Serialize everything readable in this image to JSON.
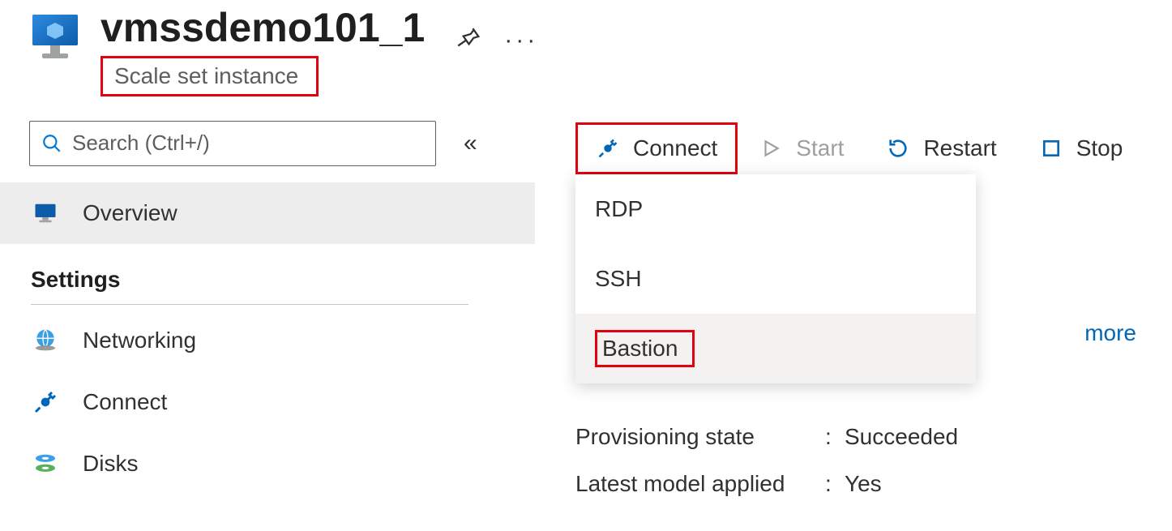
{
  "header": {
    "title": "vmssdemo101_1",
    "subtitle": "Scale set instance"
  },
  "sidebar": {
    "searchPlaceholder": "Search (Ctrl+/)",
    "overview": "Overview",
    "settingsTitle": "Settings",
    "items": {
      "networking": "Networking",
      "connect": "Connect",
      "disks": "Disks"
    }
  },
  "actions": {
    "connect": "Connect",
    "start": "Start",
    "restart": "Restart",
    "stop": "Stop"
  },
  "dropdown": {
    "rdp": "RDP",
    "ssh": "SSH",
    "bastion": "Bastion"
  },
  "link": {
    "seeMore": "more"
  },
  "details": {
    "provisioningLabel": "Provisioning state",
    "provisioningValue": "Succeeded",
    "latestModelLabel": "Latest model applied",
    "latestModelValue": "Yes"
  },
  "colors": {
    "highlight": "#e3000f",
    "azureBlue": "#0078d4",
    "link": "#0067b8"
  }
}
